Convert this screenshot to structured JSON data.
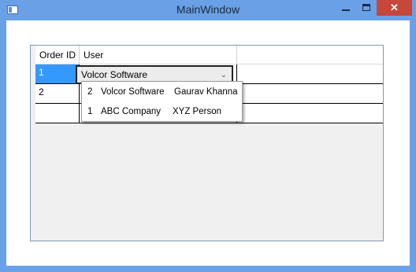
{
  "window": {
    "title": "MainWindow",
    "close_glyph": "✕"
  },
  "grid": {
    "columns": [
      "Order ID",
      "User"
    ],
    "rows": [
      {
        "order_id": "1"
      },
      {
        "order_id": "2"
      },
      {
        "order_id": ""
      }
    ],
    "combo_value": "Volcor Software",
    "chevron_glyph": "⌄"
  },
  "dropdown": {
    "options": [
      {
        "id": "2",
        "company": "Volcor Software",
        "person": "Gaurav Khanna"
      },
      {
        "id": "1",
        "company": "ABC Company",
        "person": "XYZ Person"
      }
    ]
  },
  "colors": {
    "title_bar": "#6aa0e6",
    "close_button": "#c7473a",
    "selection": "#3399ff"
  }
}
